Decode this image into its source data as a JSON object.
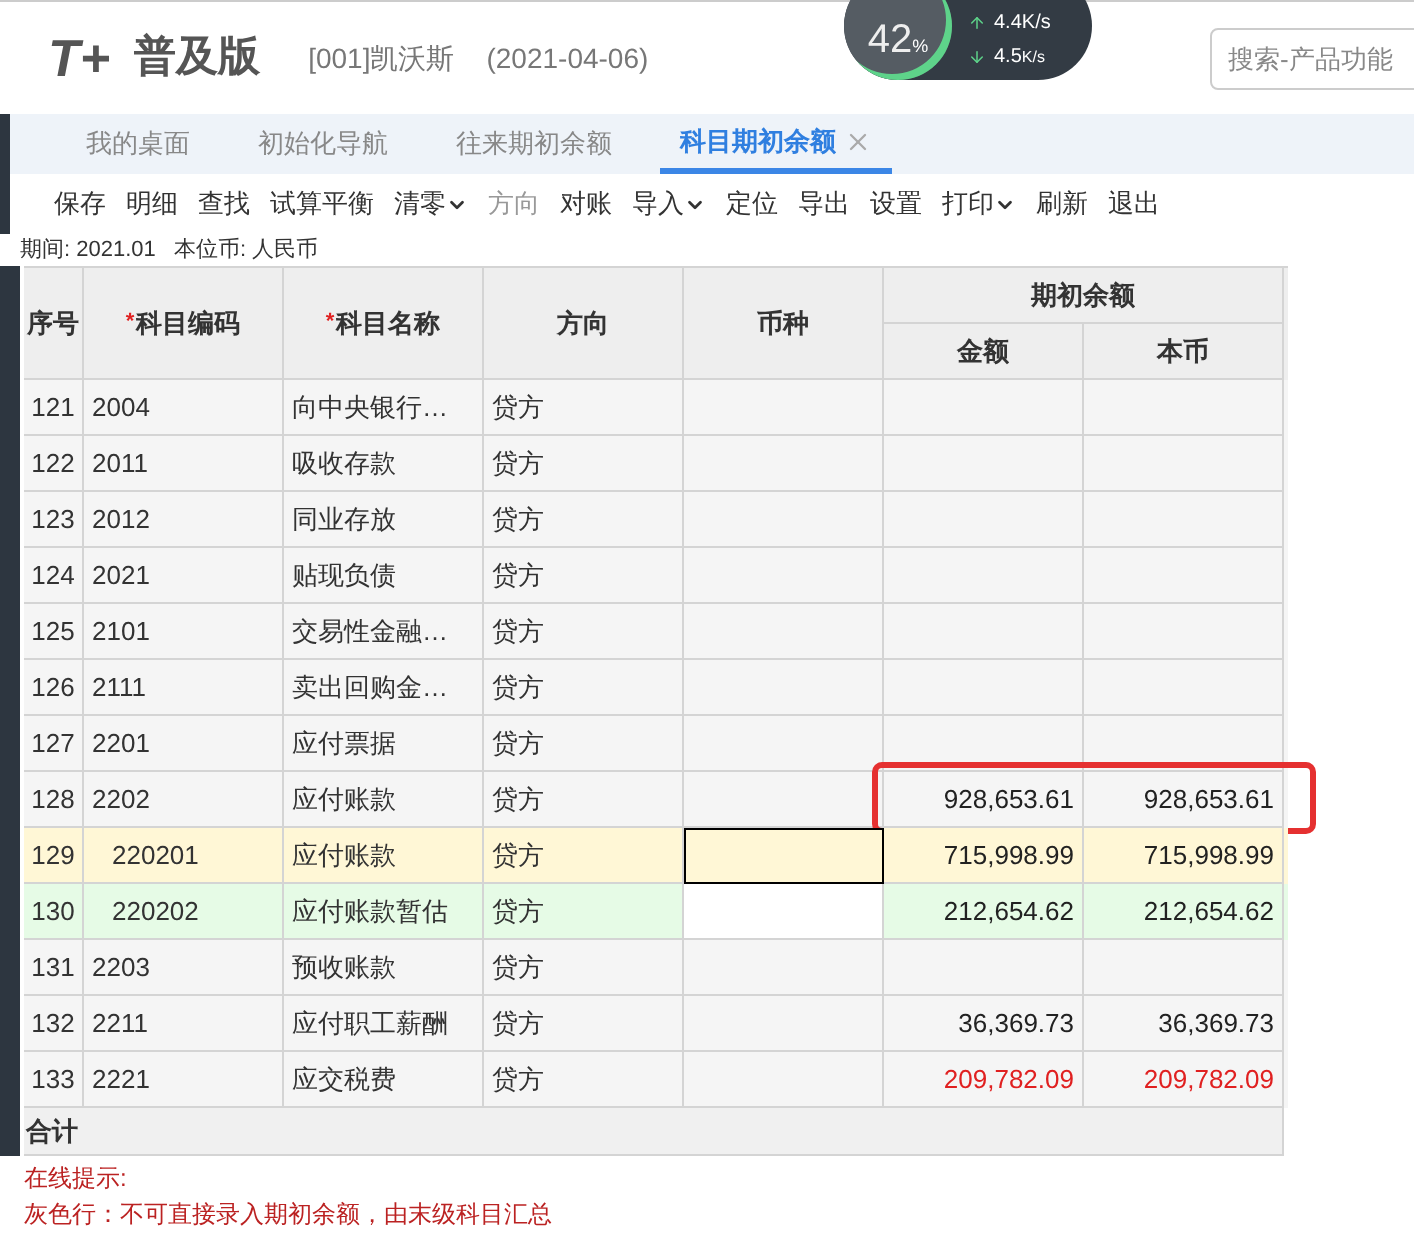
{
  "header": {
    "logo_mark": "T+",
    "logo_text": "普及版",
    "company": "[001]凯沃斯",
    "date": "(2021-04-06)",
    "search": {
      "placeholder": "搜索-产品功能"
    }
  },
  "monitor": {
    "percent": "42",
    "percent_unit": "%",
    "upload": "4.4K/s",
    "download": "4.5",
    "download_unit": "K/s",
    "level": 0.42
  },
  "tabs": [
    {
      "label": "我的桌面",
      "selected": false,
      "closable": false
    },
    {
      "label": "初始化导航",
      "selected": false,
      "closable": false
    },
    {
      "label": "往来期初余额",
      "selected": false,
      "closable": false
    },
    {
      "label": "科目期初余额",
      "selected": true,
      "closable": true
    }
  ],
  "toolbar": [
    {
      "label": "保存",
      "dropdown": false,
      "disabled": false
    },
    {
      "label": "明细",
      "dropdown": false,
      "disabled": false
    },
    {
      "label": "查找",
      "dropdown": false,
      "disabled": false
    },
    {
      "label": "试算平衡",
      "dropdown": false,
      "disabled": false
    },
    {
      "label": "清零",
      "dropdown": true,
      "disabled": false
    },
    {
      "label": "方向",
      "dropdown": false,
      "disabled": true
    },
    {
      "label": "对账",
      "dropdown": false,
      "disabled": false
    },
    {
      "label": "导入",
      "dropdown": true,
      "disabled": false
    },
    {
      "label": "定位",
      "dropdown": false,
      "disabled": false
    },
    {
      "label": "导出",
      "dropdown": false,
      "disabled": false
    },
    {
      "label": "设置",
      "dropdown": false,
      "disabled": false
    },
    {
      "label": "打印",
      "dropdown": true,
      "disabled": false
    },
    {
      "label": "刷新",
      "dropdown": false,
      "disabled": false
    },
    {
      "label": "退出",
      "dropdown": false,
      "disabled": false
    }
  ],
  "info": "期间: 2021.01   本位币: 人民币",
  "table": {
    "required_mark": "*",
    "columns": [
      {
        "label": "序号",
        "required": false
      },
      {
        "label": "科目编码",
        "required": true
      },
      {
        "label": "科目名称",
        "required": true
      },
      {
        "label": "方向",
        "required": false
      },
      {
        "label": "币种",
        "required": false
      }
    ],
    "group_label": "期初余额",
    "group_columns": [
      "金额",
      "本币"
    ],
    "rows": [
      {
        "no": "121",
        "code": "2004",
        "name": "向中央银行…",
        "direction": "贷方",
        "amount": "",
        "local": "",
        "selected": false,
        "edited": false,
        "highlighted": false,
        "children": []
      },
      {
        "no": "122",
        "code": "2011",
        "name": "吸收存款",
        "direction": "贷方",
        "amount": "",
        "local": "",
        "selected": false,
        "edited": false,
        "highlighted": false,
        "children": []
      },
      {
        "no": "123",
        "code": "2012",
        "name": "同业存放",
        "direction": "贷方",
        "amount": "",
        "local": "",
        "selected": false,
        "edited": false,
        "highlighted": false,
        "children": []
      },
      {
        "no": "124",
        "code": "2021",
        "name": "贴现负债",
        "direction": "贷方",
        "amount": "",
        "local": "",
        "selected": false,
        "edited": false,
        "highlighted": false,
        "children": []
      },
      {
        "no": "125",
        "code": "2101",
        "name": "交易性金融…",
        "direction": "贷方",
        "amount": "",
        "local": "",
        "selected": false,
        "edited": false,
        "highlighted": false,
        "children": []
      },
      {
        "no": "126",
        "code": "2111",
        "name": "卖出回购金…",
        "direction": "贷方",
        "amount": "",
        "local": "",
        "selected": false,
        "edited": false,
        "highlighted": false,
        "children": []
      },
      {
        "no": "127",
        "code": "2201",
        "name": "应付票据",
        "direction": "贷方",
        "amount": "",
        "local": "",
        "selected": false,
        "edited": false,
        "highlighted": false,
        "children": []
      },
      {
        "no": "128",
        "code": "2202",
        "name": "应付账款",
        "direction": "贷方",
        "amount": "928,653.61",
        "local": "928,653.61",
        "selected": false,
        "edited": false,
        "warning": false,
        "highlighted": true,
        "children": [
          {
            "no": "129",
            "code": "220201",
            "name": "应付账款",
            "direction": "贷方",
            "amount": "715,998.99",
            "local": "715,998.99",
            "selected": true,
            "edited": false,
            "warning": false,
            "highlighted": false
          },
          {
            "no": "130",
            "code": "220202",
            "name": "应付账款暂估",
            "direction": "贷方",
            "amount": "212,654.62",
            "local": "212,654.62",
            "selected": false,
            "edited": true,
            "warning": false,
            "highlighted": false
          }
        ]
      },
      {
        "no": "131",
        "code": "2203",
        "name": "预收账款",
        "direction": "贷方",
        "amount": "",
        "local": "",
        "selected": false,
        "edited": false,
        "highlighted": false,
        "children": []
      },
      {
        "no": "132",
        "code": "2211",
        "name": "应付职工薪酬",
        "direction": "贷方",
        "amount": "36,369.73",
        "local": "36,369.73",
        "selected": false,
        "edited": false,
        "warning": false,
        "highlighted": false,
        "children": []
      },
      {
        "no": "133",
        "code": "2221",
        "name": "应交税费",
        "direction": "贷方",
        "amount": "209,782.09",
        "local": "209,782.09",
        "selected": false,
        "edited": false,
        "warning": true,
        "highlighted": false,
        "children": []
      }
    ],
    "total_label": "合计"
  },
  "tips": {
    "title": "在线提示:",
    "lines": [
      "灰色行：不可直接录入期初余额，由末级科目汇总"
    ]
  }
}
